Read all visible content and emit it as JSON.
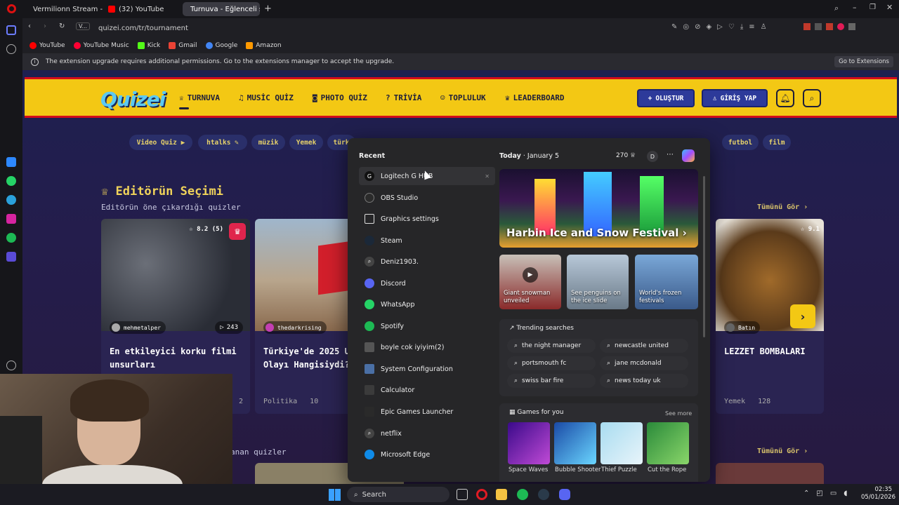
{
  "browser": {
    "tabs": [
      {
        "label": "Vermilionn Stream - Watc",
        "active": false,
        "color": "#53fc18"
      },
      {
        "label": "(32) YouTube",
        "active": false,
        "color": "#ff0000"
      },
      {
        "label": "Turnuva - Eğlenceli seçim",
        "active": true,
        "color": "#f3c814"
      }
    ],
    "url": "quizei.com/tr/tournament",
    "site_chip": "V...",
    "bookmarks": [
      {
        "label": "YouTube",
        "color": "#ff0000"
      },
      {
        "label": "YouTube Music",
        "color": "#ff0033"
      },
      {
        "label": "Kick",
        "color": "#53fc18"
      },
      {
        "label": "Gmail",
        "color": "#ea4335"
      },
      {
        "label": "Google",
        "color": "#4285f4"
      },
      {
        "label": "Amazon",
        "color": "#ff9900"
      }
    ],
    "infobar_text": "The extension upgrade requires additional permissions. Go to the extensions manager to accept the upgrade.",
    "infobar_button": "Go to Extensions"
  },
  "site": {
    "logo": "Quizei",
    "nav": [
      "TURNUVA",
      "MUSİC QUİZ",
      "PHOTO QUİZ",
      "TRİVİA",
      "TOPLULUK",
      "LEADERBOARD"
    ],
    "create_button": "OLUŞTUR",
    "login_button": "GİRİŞ YAP",
    "chips_left": [
      "Video Quiz ▶",
      "htalks ✎",
      "müzik",
      "Yemek",
      "türk"
    ],
    "chips_right": [
      "futbol",
      "film"
    ],
    "section_title": "Editörün Seçimi",
    "section_sub": "Editörün öne çıkardığı quizler",
    "see_all": "Tümünü Gör",
    "see_all_2": "Tümünü Gör",
    "second_section_partial": "anan quizler",
    "cards": [
      {
        "rating": "8.2 (5)",
        "author": "mehmetalper",
        "plays": "243",
        "title": "En etkileyici korku filmi unsurları",
        "category": "",
        "count": "2"
      },
      {
        "rating": "",
        "author": "thedarkrising",
        "plays": "",
        "title": "Türkiye'de 2025 Unutulmaz Olayı Hangisiydi?",
        "category": "Politika",
        "count": "10"
      },
      {
        "rating": "9.1",
        "author": "Batın",
        "plays": "",
        "title": "LEZZET BOMBALARI",
        "category": "Yemek",
        "count": "128"
      }
    ]
  },
  "startmenu": {
    "recent_title": "Recent",
    "recent": [
      {
        "label": "Logitech G HUB",
        "icon": "logitech-icon",
        "color": "#111111"
      },
      {
        "label": "OBS Studio",
        "icon": "obs-icon",
        "color": "#2b2b2b"
      },
      {
        "label": "Graphics settings",
        "icon": "monitor-icon",
        "color": "#3a3a3a"
      },
      {
        "label": "Steam",
        "icon": "steam-icon",
        "color": "#1b2838"
      },
      {
        "label": "Deniz1903.",
        "icon": "search-icon",
        "color": "#444444"
      },
      {
        "label": "Discord",
        "icon": "discord-icon",
        "color": "#5865f2"
      },
      {
        "label": "WhatsApp",
        "icon": "whatsapp-icon",
        "color": "#25d366"
      },
      {
        "label": "Spotify",
        "icon": "spotify-icon",
        "color": "#1db954"
      },
      {
        "label": "boyle cok iyiyim(2)",
        "icon": "video-file-icon",
        "color": "#555555"
      },
      {
        "label": "System Configuration",
        "icon": "sysconfig-icon",
        "color": "#4a6fa5"
      },
      {
        "label": "Calculator",
        "icon": "calculator-icon",
        "color": "#3b3b3b"
      },
      {
        "label": "Epic Games Launcher",
        "icon": "epic-icon",
        "color": "#2a2a2a"
      },
      {
        "label": "netflix",
        "icon": "search-icon",
        "color": "#444444"
      },
      {
        "label": "Microsoft Edge",
        "icon": "edge-icon",
        "color": "#0f8be8"
      }
    ],
    "today": "Today",
    "date": "January 5",
    "points": "270",
    "avatar_letter": "D",
    "hero_title": "Harbin Ice and Snow Festival",
    "thumbs": [
      "Giant snowman unveiled",
      "See penguins on the ice slide",
      "World's frozen festivals"
    ],
    "trending_title": "Trending searches",
    "trending": [
      "the night manager",
      "newcastle united",
      "portsmouth fc",
      "jane mcdonald",
      "swiss bar fire",
      "news today uk"
    ],
    "games_title": "Games for you",
    "see_more": "See more",
    "games": [
      {
        "label": "Space Waves",
        "color": "#7a2cd6"
      },
      {
        "label": "Bubble Shooter",
        "color": "#2b6fd6"
      },
      {
        "label": "Thief Puzzle",
        "color": "#7bc4e8"
      },
      {
        "label": "Cut the Rope",
        "color": "#3aa64a"
      }
    ]
  },
  "taskbar": {
    "search": "Search",
    "time": "02:35",
    "date": "05/01/2026"
  }
}
